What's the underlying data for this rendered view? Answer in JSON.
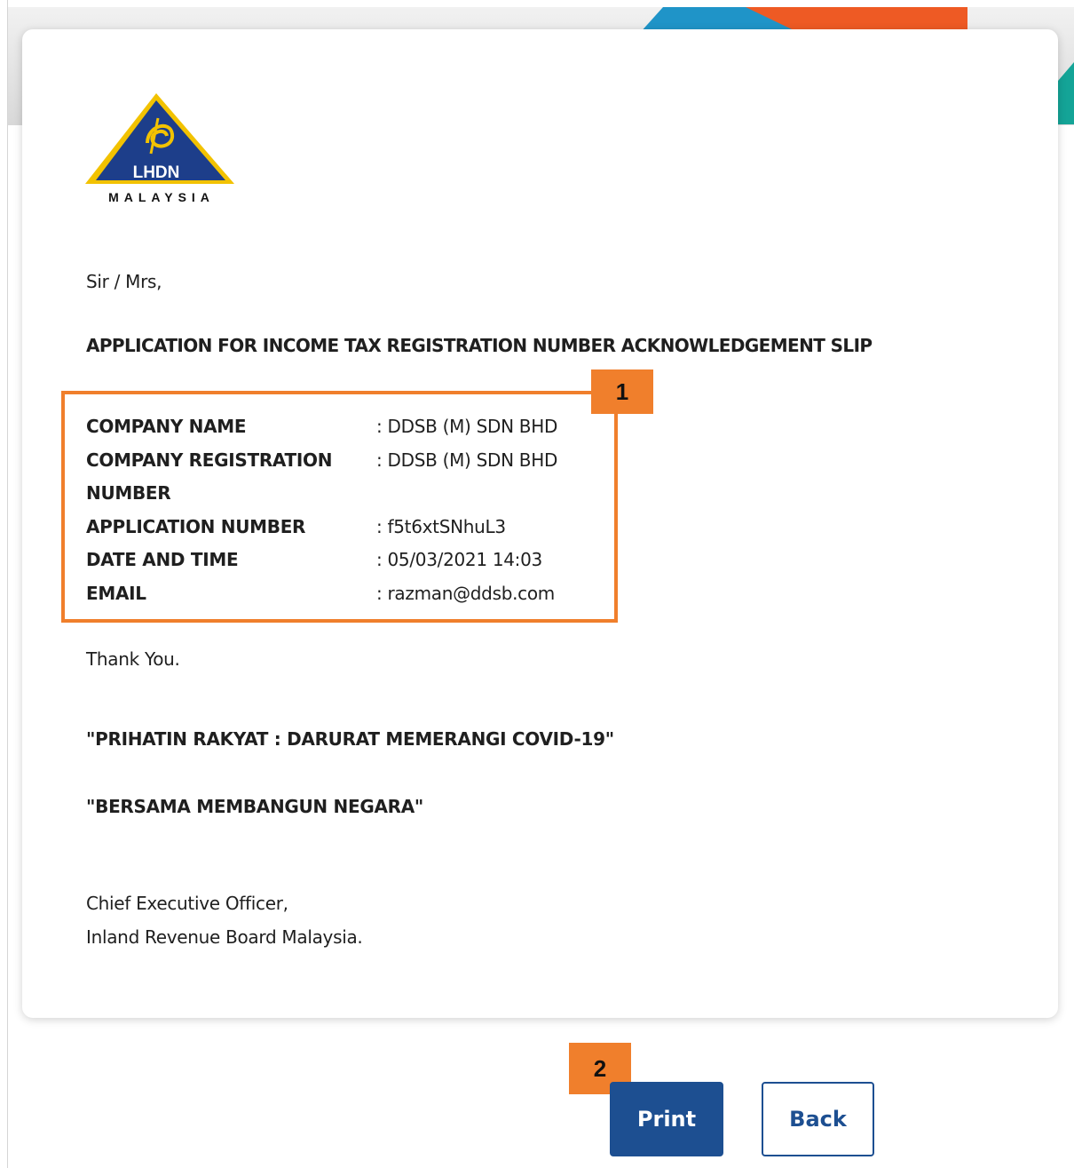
{
  "logo": {
    "emblem_text": "LHDN",
    "subtext": "MALAYSIA",
    "colors": {
      "triangle": "#1d3e8a",
      "gold": "#f2c200",
      "text": "#ffffff"
    }
  },
  "letter": {
    "salutation": "Sir / Mrs,",
    "heading": "APPLICATION FOR INCOME TAX REGISTRATION NUMBER ACKNOWLEDGEMENT SLIP",
    "fields": [
      {
        "label": "COMPANY NAME",
        "value": ": DDSB (M) SDN BHD"
      },
      {
        "label": "COMPANY REGISTRATION",
        "label_line2": "NUMBER",
        "value": ": DDSB (M) SDN BHD"
      },
      {
        "label": "APPLICATION NUMBER",
        "value": ": f5t6xtSNhuL3"
      },
      {
        "label": "DATE AND TIME",
        "value": ": 05/03/2021 14:03"
      },
      {
        "label": "EMAIL",
        "value": ": razman@ddsb.com"
      }
    ],
    "thanks": "Thank You.",
    "slogan1": "\"PRIHATIN RAKYAT : DARURAT MEMERANGI COVID-19\"",
    "slogan2": "\"BERSAMA MEMBANGUN NEGARA\"",
    "signature_line1": "Chief Executive Officer,",
    "signature_line2": "Inland Revenue Board Malaysia."
  },
  "markers": {
    "marker1": "1",
    "marker2": "2"
  },
  "buttons": {
    "print_label": "Print",
    "back_label": "Back"
  },
  "colors": {
    "accent": "#f07f2c",
    "primary": "#1d4f91"
  }
}
